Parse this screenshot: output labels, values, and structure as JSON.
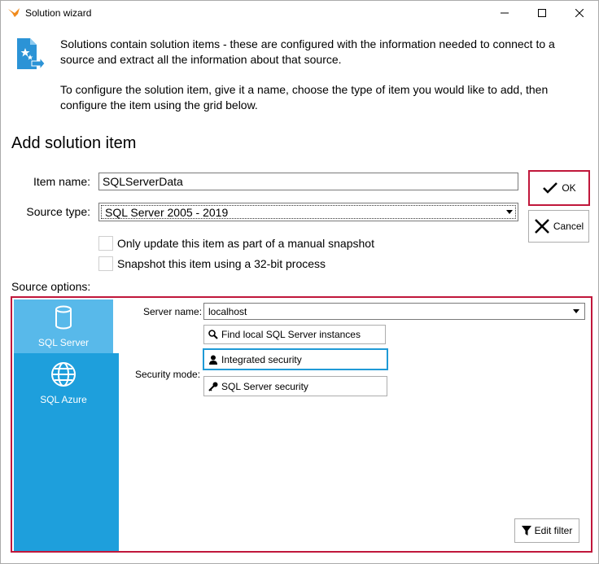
{
  "window": {
    "title": "Solution wizard",
    "controls": [
      "minimize-icon",
      "maximize-icon",
      "close-icon"
    ]
  },
  "intro": {
    "icon": "solution-item-icon",
    "paragraph1": "Solutions contain solution items - these are configured with the information needed to connect to a source and extract all the information about that source.",
    "paragraph2": "To configure the solution item, give it a name, choose the type of item you would like to add, then configure the item using the grid below."
  },
  "heading": "Add solution item",
  "form": {
    "item_name_label": "Item name:",
    "item_name_value": "SQLServerData",
    "source_type_label": "Source type:",
    "source_type_value": "SQL Server 2005 - 2019",
    "checkbox_manual_snapshot": "Only update this item as part of a manual snapshot",
    "checkbox_32bit": "Snapshot this item using a 32-bit process"
  },
  "buttons": {
    "ok": "OK",
    "cancel": "Cancel"
  },
  "source_options": {
    "label": "Source options:",
    "nav": [
      {
        "label": "SQL Server",
        "icon": "database-icon",
        "selected": true
      },
      {
        "label": "SQL Azure",
        "icon": "globe-icon",
        "selected": false
      }
    ],
    "server_name_label": "Server name:",
    "server_name_value": "localhost",
    "find_instances": "Find local SQL Server instances",
    "security_mode_label": "Security mode:",
    "integrated_security": "Integrated security",
    "sql_server_security": "SQL Server security",
    "edit_filter": "Edit filter"
  },
  "colors": {
    "accent_red": "#c0173b",
    "nav_blue": "#1e9fdc",
    "nav_selected": "#58b9ea",
    "focus_blue": "#1f9ad6"
  }
}
